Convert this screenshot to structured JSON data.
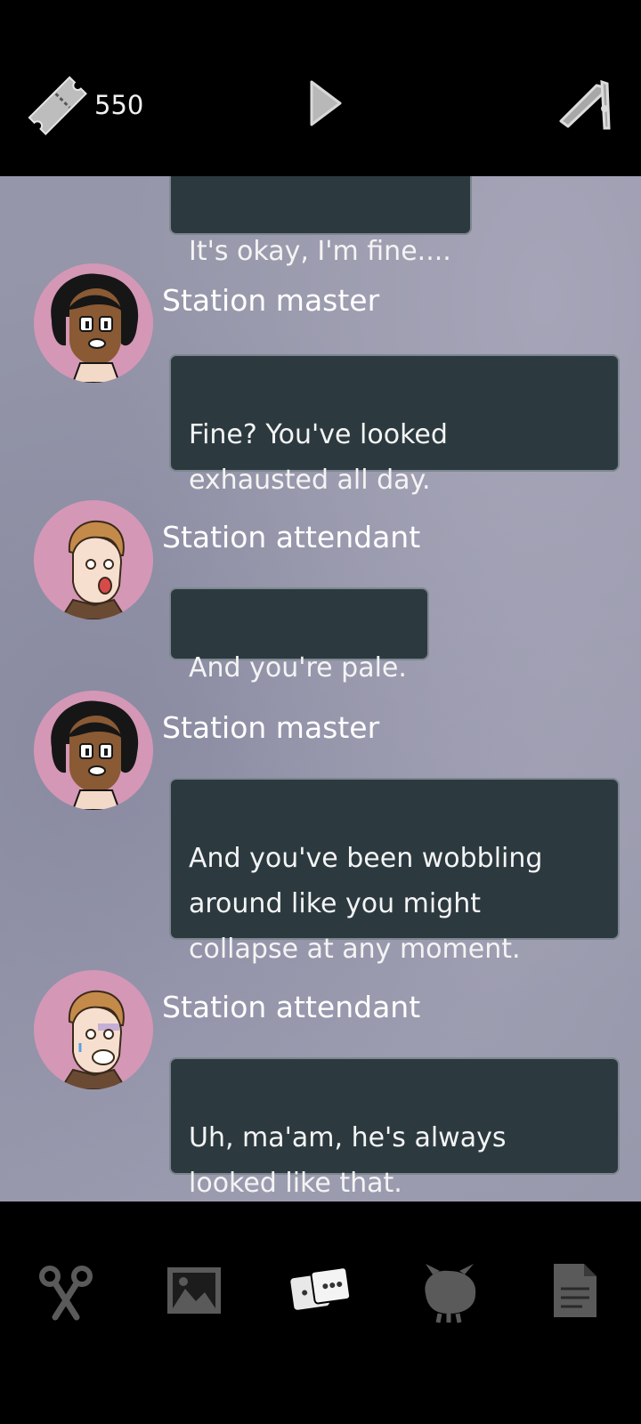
{
  "header": {
    "ticket_count": "550",
    "icons": [
      "ticket-icon",
      "play-icon",
      "quill-pen-icon"
    ]
  },
  "chat": {
    "messages": [
      {
        "speaker": "",
        "text": "It's okay, I'm fine...."
      },
      {
        "speaker": "Station master",
        "text": "Fine? You've looked\nexhausted all day."
      },
      {
        "speaker": "Station attendant",
        "text": "And you're pale."
      },
      {
        "speaker": "Station master",
        "text": "And you've been wobbling\naround like you might\ncollapse at any moment."
      },
      {
        "speaker": "Station attendant",
        "text": "Uh, ma'am, he's always\nlooked like that."
      }
    ]
  },
  "nav": {
    "items": [
      "scissors-icon",
      "photos-icon",
      "chat-cards-icon",
      "creature-icon",
      "notes-icon"
    ],
    "active": "chat-cards-icon"
  },
  "colors": {
    "bubble": "#2c3a40",
    "avatar_bg": "#d597b6",
    "chat_bg": "#9596a9"
  }
}
